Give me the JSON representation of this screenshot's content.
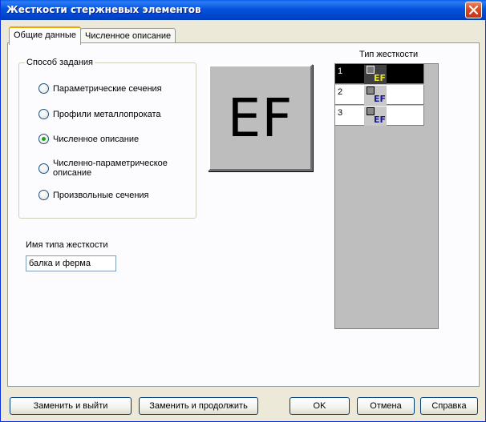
{
  "window": {
    "title": "Жесткости стержневых элементов"
  },
  "tabs": [
    {
      "label": "Общие данные",
      "active": true
    },
    {
      "label": "Численное описание",
      "active": false
    }
  ],
  "method_group": {
    "legend": "Способ задания",
    "options": [
      {
        "label": "Параметрические сечения",
        "checked": false
      },
      {
        "label": "Профили металлопроката",
        "checked": false
      },
      {
        "label": "Численное описание",
        "checked": true
      },
      {
        "label": "Численно-параметрическое описание",
        "checked": false
      },
      {
        "label": "Произвольные сечения",
        "checked": false
      }
    ]
  },
  "stiffness_name": {
    "label": "Имя типа жесткости",
    "value": "балка и ферма"
  },
  "preview": {
    "text": "EF"
  },
  "stiffness_list": {
    "header": "Тип жесткости",
    "rows": [
      {
        "num": "1",
        "icon_text": "EF",
        "selected": true
      },
      {
        "num": "2",
        "icon_text": "EF",
        "selected": false
      },
      {
        "num": "3",
        "icon_text": "EF",
        "selected": false
      }
    ]
  },
  "buttons": {
    "replace_exit": "Заменить и выйти",
    "replace_continue": "Заменить и продолжить",
    "ok": "OK",
    "cancel": "Отмена",
    "help": "Справка"
  },
  "colors": {
    "titlebar": "#0553dd",
    "dialog_bg": "#ece9d8",
    "list_selected_bg": "#000000",
    "ef_icon_text": "#1a1a8f",
    "ef_icon_text_selected": "#e8e020"
  }
}
